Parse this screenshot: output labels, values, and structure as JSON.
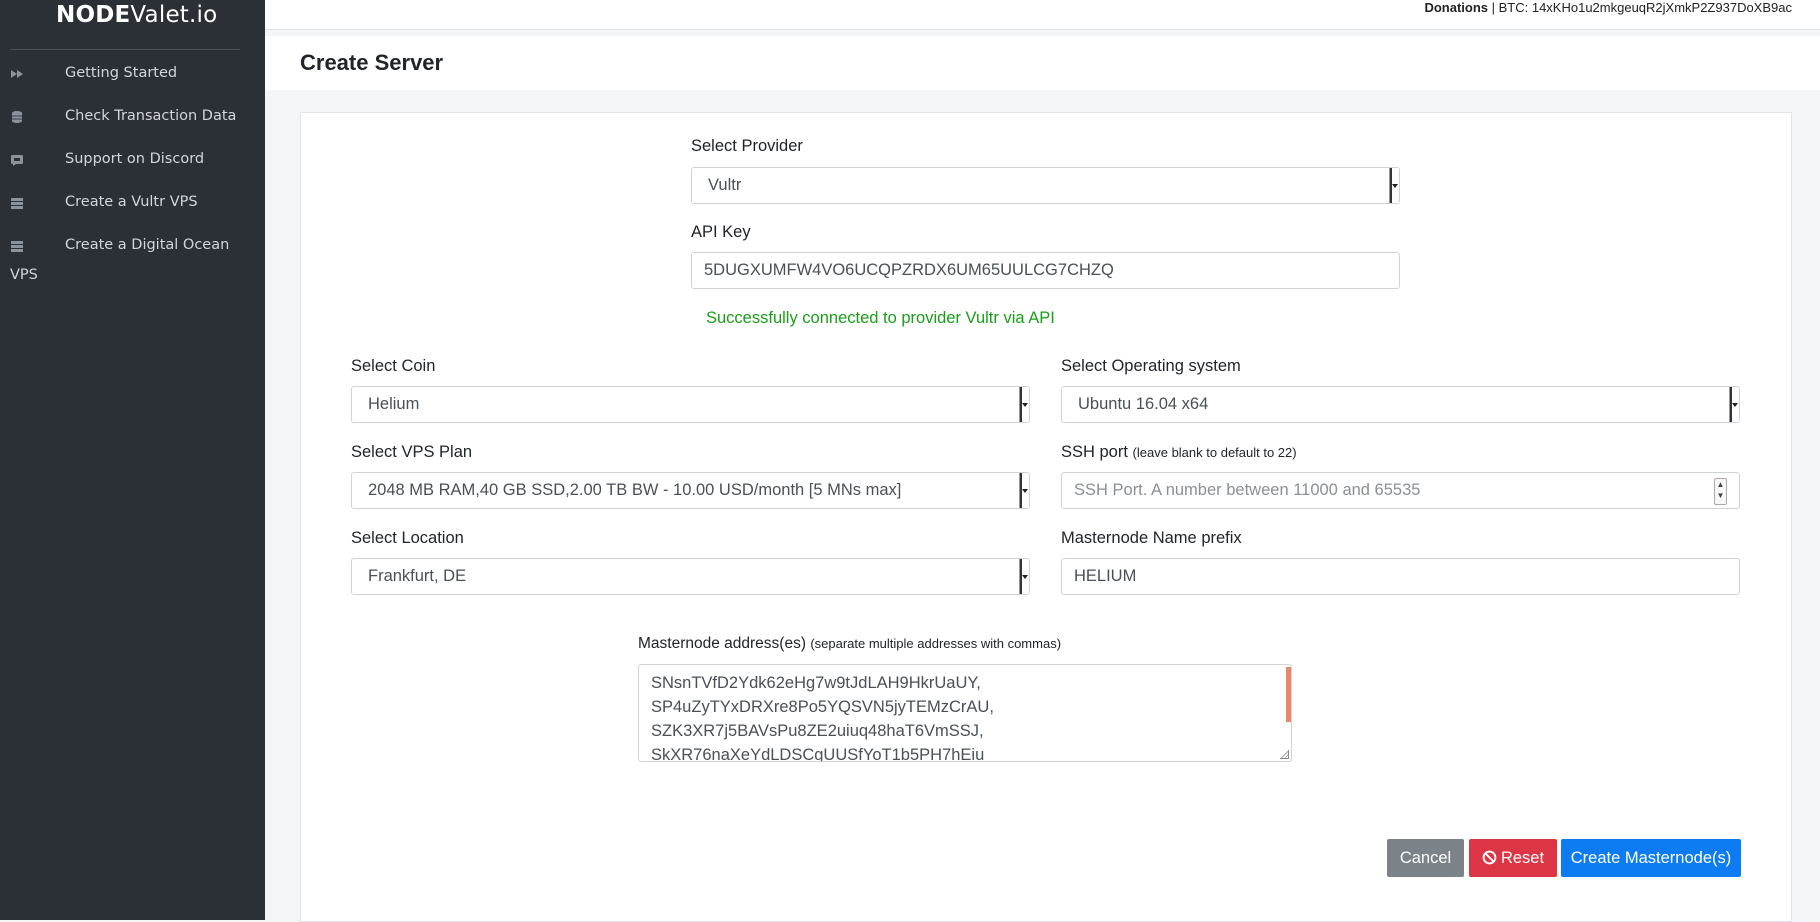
{
  "brand": {
    "bold": "NODE",
    "rest": "Valet.io"
  },
  "sidebar": {
    "items": [
      {
        "label": "Getting Started",
        "icon": "fast-forward-icon"
      },
      {
        "label": "Check Transaction Data",
        "icon": "database-icon"
      },
      {
        "label": "Support on Discord",
        "icon": "chat-icon"
      },
      {
        "label": "Create a Vultr VPS",
        "icon": "server-icon"
      },
      {
        "label": "Create a Digital Ocean",
        "label_wrap": "VPS",
        "icon": "server-icon"
      }
    ]
  },
  "topbar": {
    "donations_label": "Donations",
    "donations_text": " | BTC: 14xKHo1u2mkgeuqR2jXmkP2Z937DoXB9ac"
  },
  "page": {
    "title": "Create Server"
  },
  "form": {
    "provider": {
      "label": "Select Provider",
      "value": "Vultr"
    },
    "api_key": {
      "label": "API Key",
      "value": "5DUGXUMFW4VO6UCQPZRDX6UM65UULCG7CHZQ"
    },
    "status": "Successfully connected to provider Vultr via API",
    "coin": {
      "label": "Select Coin",
      "value": "Helium"
    },
    "os": {
      "label": "Select Operating system",
      "value": "Ubuntu 16.04 x64"
    },
    "plan": {
      "label": "Select VPS Plan",
      "value": "2048 MB RAM,40 GB SSD,2.00 TB BW - 10.00 USD/month [5 MNs max]"
    },
    "ssh_port": {
      "label": "SSH port",
      "hint": "(leave blank to default to 22)",
      "placeholder": "SSH Port. A number between 11000 and 65535"
    },
    "location": {
      "label": "Select Location",
      "value": "Frankfurt, DE"
    },
    "name_prefix": {
      "label": "Masternode Name prefix",
      "value": "HELIUM"
    },
    "addresses": {
      "label": "Masternode address(es)",
      "hint": "(separate multiple addresses with commas)",
      "lines": [
        "SNsnTVfD2Ydk62eHg7w9tJdLAH9HkrUaUY,",
        "SP4uZyTYxDRXre8Po5YQSVN5jyTEMzCrAU,",
        "SZK3XR7j5BAVsPu8ZE2uiuq48haT6VmSSJ,",
        "SkXR76naXeYdLDSCgUUSfYoT1b5PH7hEiu"
      ]
    }
  },
  "buttons": {
    "cancel": "Cancel",
    "reset": "Reset",
    "create": "Create Masternode(s)"
  },
  "colors": {
    "sidebar_bg": "#2b2f36",
    "success": "#1a9e1a",
    "danger": "#dc3545",
    "primary": "#0d7cf2",
    "secondary": "#7b8288"
  }
}
